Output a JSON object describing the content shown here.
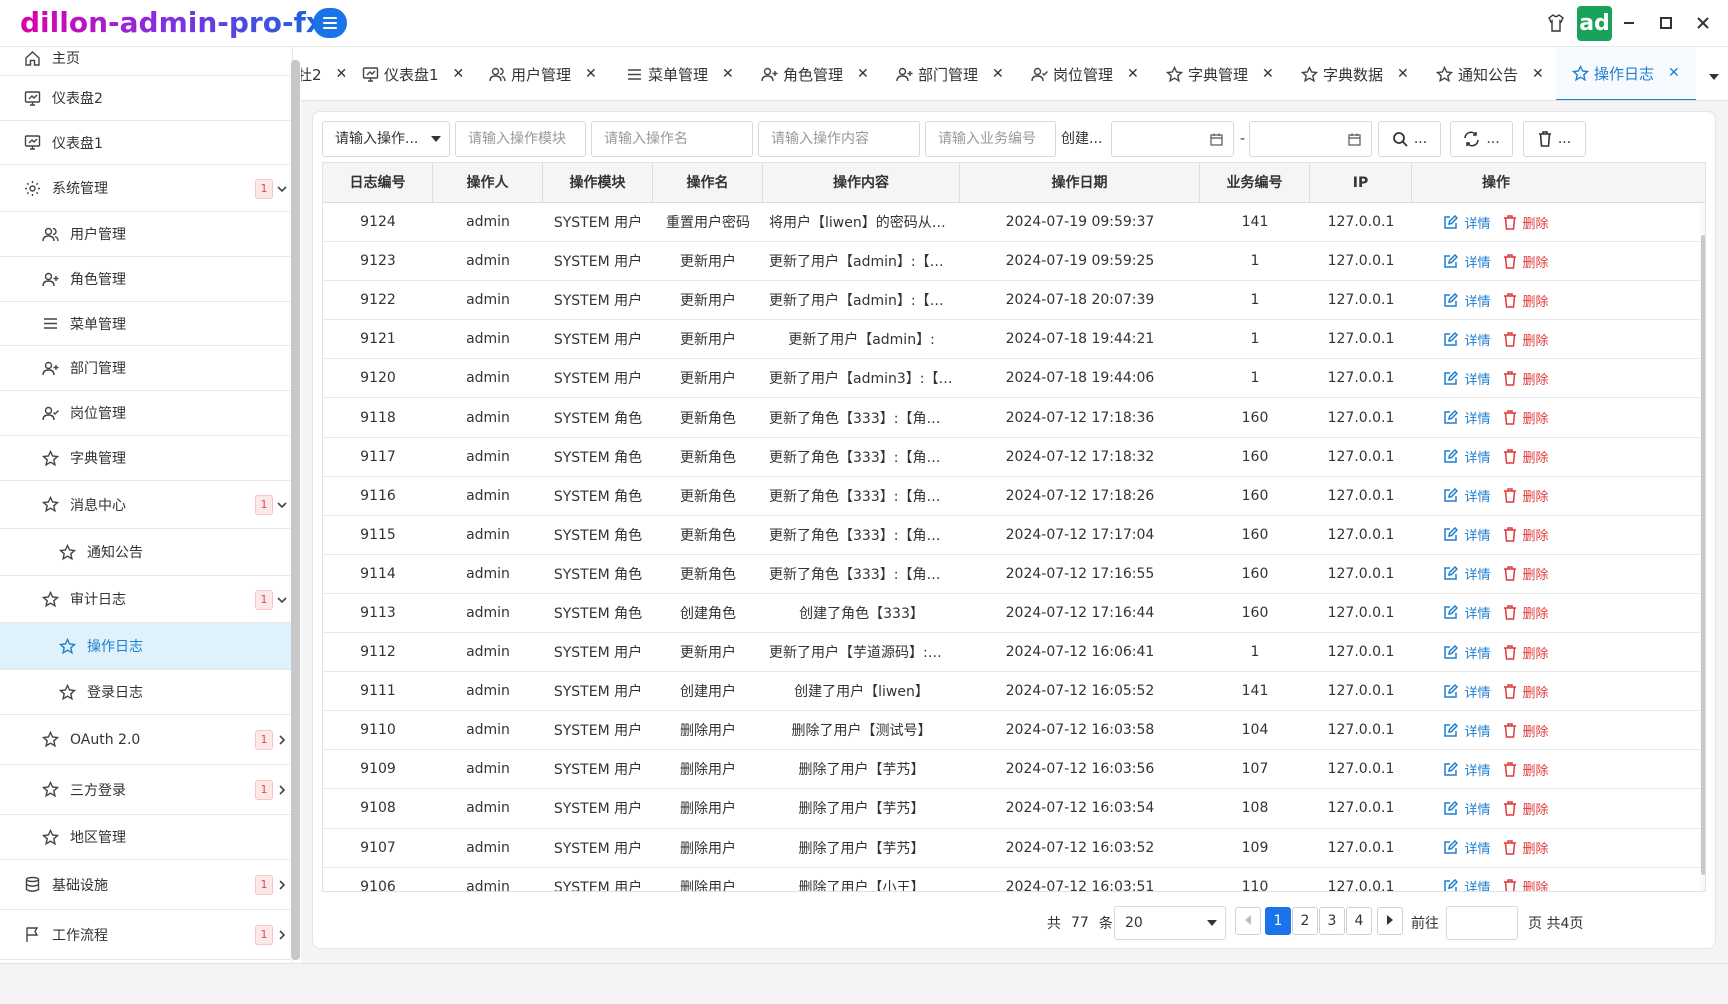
{
  "app": {
    "title": "dillon-admin-pro-fx",
    "avatar_text": "ad"
  },
  "colors": {
    "primary": "#1a73e8",
    "danger": "#e03a3a",
    "active_bg": "#dff2fb",
    "avatar_bg": "#19a35a"
  },
  "sidebar": {
    "items": [
      {
        "label": "主页",
        "icon": "home-icon"
      },
      {
        "label": "仪表盘2",
        "icon": "dashboard-icon"
      },
      {
        "label": "仪表盘1",
        "icon": "dashboard-icon"
      },
      {
        "label": "系统管理",
        "icon": "gear-icon",
        "badge": "1"
      },
      {
        "label": "用户管理",
        "icon": "users-icon"
      },
      {
        "label": "角色管理",
        "icon": "user-plus-icon"
      },
      {
        "label": "菜单管理",
        "icon": "menu-icon"
      },
      {
        "label": "部门管理",
        "icon": "user-plus-icon"
      },
      {
        "label": "岗位管理",
        "icon": "user-check-icon"
      },
      {
        "label": "字典管理",
        "icon": "star-icon"
      },
      {
        "label": "消息中心",
        "icon": "star-icon",
        "badge": "1"
      },
      {
        "label": "通知公告",
        "icon": "star-icon"
      },
      {
        "label": "审计日志",
        "icon": "star-icon",
        "badge": "1"
      },
      {
        "label": "操作日志",
        "icon": "star-icon"
      },
      {
        "label": "登录日志",
        "icon": "star-icon"
      },
      {
        "label": "OAuth 2.0",
        "icon": "star-icon",
        "badge": "1"
      },
      {
        "label": "三方登录",
        "icon": "star-icon",
        "badge": "1"
      },
      {
        "label": "地区管理",
        "icon": "star-icon"
      },
      {
        "label": "基础设施",
        "icon": "database-icon",
        "badge": "1"
      },
      {
        "label": "工作流程",
        "icon": "flag-icon",
        "badge": "1"
      }
    ]
  },
  "tabs": [
    {
      "label": "牡2"
    },
    {
      "label": "仪表盘1"
    },
    {
      "label": "用户管理"
    },
    {
      "label": "菜单管理"
    },
    {
      "label": "角色管理"
    },
    {
      "label": "部门管理"
    },
    {
      "label": "岗位管理"
    },
    {
      "label": "字典管理"
    },
    {
      "label": "字典数据"
    },
    {
      "label": "通知公告"
    },
    {
      "label": "操作日志"
    }
  ],
  "filters": {
    "module_select": "请输入操作...",
    "module_placeholder": "请输入操作模块",
    "name_placeholder": "请输入操作名",
    "content_placeholder": "请输入操作内容",
    "biz_placeholder": "请输入业务编号",
    "created_label": "创建...",
    "date_sep": "-",
    "search_label": "...",
    "reset_label": "...",
    "clear_label": "..."
  },
  "table": {
    "columns": [
      "日志编号",
      "操作人",
      "操作模块",
      "操作名",
      "操作内容",
      "操作日期",
      "业务编号",
      "IP",
      "操作"
    ],
    "edit_label": "详情",
    "delete_label": "删除",
    "rows": [
      [
        "9124",
        "admin",
        "SYSTEM 用户",
        "重置用户密码",
        "将用户【liwen】的密码从【$...",
        "2024-07-19 09:59:37",
        "141",
        "127.0.0.1"
      ],
      [
        "9123",
        "admin",
        "SYSTEM 用户",
        "更新用户",
        "更新了用户【admin】:【用户...",
        "2024-07-19 09:59:25",
        "1",
        "127.0.0.1"
      ],
      [
        "9122",
        "admin",
        "SYSTEM 用户",
        "更新用户",
        "更新了用户【admin】:【用户...",
        "2024-07-18 20:07:39",
        "1",
        "127.0.0.1"
      ],
      [
        "9121",
        "admin",
        "SYSTEM 用户",
        "更新用户",
        "更新了用户【admin】:",
        "2024-07-18 19:44:21",
        "1",
        "127.0.0.1"
      ],
      [
        "9120",
        "admin",
        "SYSTEM 用户",
        "更新用户",
        "更新了用户【admin3】:【用...",
        "2024-07-18 19:44:06",
        "1",
        "127.0.0.1"
      ],
      [
        "9118",
        "admin",
        "SYSTEM 角色",
        "更新角色",
        "更新了角色【333】:【角色标...",
        "2024-07-12 17:18:36",
        "160",
        "127.0.0.1"
      ],
      [
        "9117",
        "admin",
        "SYSTEM 角色",
        "更新角色",
        "更新了角色【333】:【角色标...",
        "2024-07-12 17:18:32",
        "160",
        "127.0.0.1"
      ],
      [
        "9116",
        "admin",
        "SYSTEM 角色",
        "更新角色",
        "更新了角色【333】:【角色标...",
        "2024-07-12 17:18:26",
        "160",
        "127.0.0.1"
      ],
      [
        "9115",
        "admin",
        "SYSTEM 角色",
        "更新角色",
        "更新了角色【333】:【角色标...",
        "2024-07-12 17:17:04",
        "160",
        "127.0.0.1"
      ],
      [
        "9114",
        "admin",
        "SYSTEM 角色",
        "更新角色",
        "更新了角色【333】:【角色标...",
        "2024-07-12 17:16:55",
        "160",
        "127.0.0.1"
      ],
      [
        "9113",
        "admin",
        "SYSTEM 角色",
        "创建角色",
        "创建了角色【333】",
        "2024-07-12 17:16:44",
        "160",
        "127.0.0.1"
      ],
      [
        "9112",
        "admin",
        "SYSTEM 用户",
        "更新用户",
        "更新了用户【芋道源码】:【...",
        "2024-07-12 16:06:41",
        "1",
        "127.0.0.1"
      ],
      [
        "9111",
        "admin",
        "SYSTEM 用户",
        "创建用户",
        "创建了用户【liwen】",
        "2024-07-12 16:05:52",
        "141",
        "127.0.0.1"
      ],
      [
        "9110",
        "admin",
        "SYSTEM 用户",
        "删除用户",
        "删除了用户【测试号】",
        "2024-07-12 16:03:58",
        "104",
        "127.0.0.1"
      ],
      [
        "9109",
        "admin",
        "SYSTEM 用户",
        "删除用户",
        "删除了用户【芋艿】",
        "2024-07-12 16:03:56",
        "107",
        "127.0.0.1"
      ],
      [
        "9108",
        "admin",
        "SYSTEM 用户",
        "删除用户",
        "删除了用户【芋艿】",
        "2024-07-12 16:03:54",
        "108",
        "127.0.0.1"
      ],
      [
        "9107",
        "admin",
        "SYSTEM 用户",
        "删除用户",
        "删除了用户【芋艿】",
        "2024-07-12 16:03:52",
        "109",
        "127.0.0.1"
      ],
      [
        "9106",
        "admin",
        "SYSTEM 用户",
        "删除用户",
        "删除了用户【小王】",
        "2024-07-12 16:03:51",
        "110",
        "127.0.0.1"
      ]
    ]
  },
  "pagination": {
    "total_prefix": "共",
    "total": "77",
    "total_suffix": "条",
    "page_size": "20",
    "pages": [
      "1",
      "2",
      "3",
      "4"
    ],
    "current": "1",
    "goto_label": "前往",
    "goto_value": "",
    "page_suffix": "页 共4页"
  }
}
